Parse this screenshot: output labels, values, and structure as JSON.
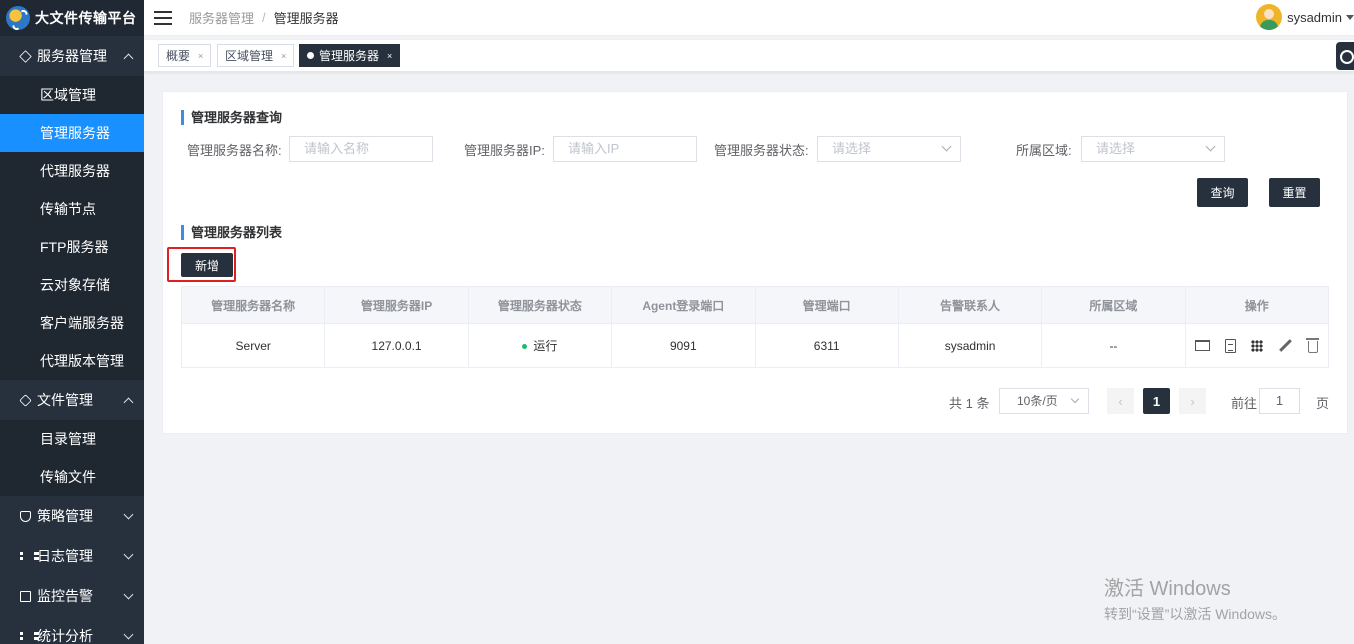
{
  "app": {
    "title": "大文件传输平台"
  },
  "sidebar": {
    "groups": [
      {
        "label": "服务器管理",
        "icon": "cube-icon",
        "expanded": true,
        "items": [
          "区域管理",
          "管理服务器",
          "代理服务器",
          "传输节点",
          "FTP服务器",
          "云对象存储",
          "客户端服务器",
          "代理版本管理"
        ]
      },
      {
        "label": "文件管理",
        "icon": "layers-icon",
        "expanded": true,
        "items": [
          "目录管理",
          "传输文件"
        ]
      },
      {
        "label": "策略管理",
        "icon": "shield-icon",
        "expanded": false
      },
      {
        "label": "日志管理",
        "icon": "list-icon",
        "expanded": false
      },
      {
        "label": "监控告警",
        "icon": "monitor-icon",
        "expanded": false
      },
      {
        "label": "统计分析",
        "icon": "list-icon",
        "expanded": false
      }
    ],
    "active_item": "管理服务器"
  },
  "header": {
    "breadcrumb": [
      "服务器管理",
      "管理服务器"
    ],
    "separator": "/",
    "user": "sysadmin"
  },
  "tabs": [
    {
      "label": "概要",
      "close": "×",
      "active": false
    },
    {
      "label": "区域管理",
      "close": "×",
      "active": false
    },
    {
      "label": "管理服务器",
      "close": "×",
      "active": true
    }
  ],
  "query": {
    "title": "管理服务器查询",
    "name_label": "管理服务器名称:",
    "name_placeholder": "请输入名称",
    "ip_label": "管理服务器IP:",
    "ip_placeholder": "请输入IP",
    "status_label": "管理服务器状态:",
    "status_placeholder": "请选择",
    "region_label": "所属区域:",
    "region_placeholder": "请选择",
    "search_btn": "查询",
    "reset_btn": "重置"
  },
  "list": {
    "title": "管理服务器列表",
    "add_btn": "新增",
    "columns": [
      "管理服务器名称",
      "管理服务器IP",
      "管理服务器状态",
      "Agent登录端口",
      "管理端口",
      "告警联系人",
      "所属区域",
      "操作"
    ],
    "rows": [
      {
        "name": "Server",
        "ip": "127.0.0.1",
        "status": "运行",
        "agent_port": "9091",
        "mgmt_port": "6311",
        "contact": "sysadmin",
        "region": "--"
      }
    ],
    "status_color": "#19be6b"
  },
  "pagination": {
    "total": "共 1 条",
    "page_size": "10条/页",
    "prev": "‹",
    "current": "1",
    "next": "›",
    "goto_label": "前往",
    "goto_value": "1",
    "page_suffix": "页"
  },
  "watermark": {
    "line1": "激活 Windows",
    "line2": "转到“设置”以激活 Windows。"
  },
  "colors": {
    "sidebar_bg": "#27313d",
    "accent": "#1890ff",
    "dark_btn": "#27313d"
  }
}
